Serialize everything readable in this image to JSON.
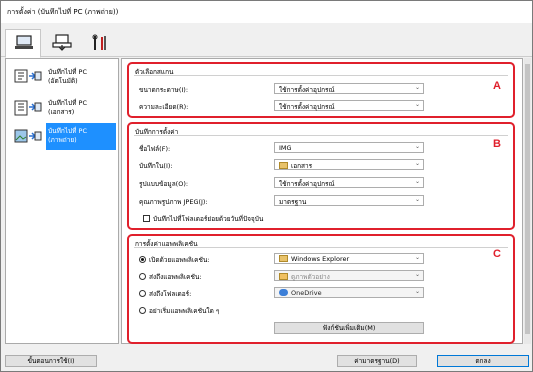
{
  "window": {
    "title": "การตั้งค่า (บันทึกไปที่ PC (ภาพถ่าย))"
  },
  "tabs": [
    {
      "icon": "computer-icon"
    },
    {
      "icon": "scanner-icon"
    },
    {
      "icon": "tools-icon"
    }
  ],
  "sidebar": {
    "items": [
      {
        "label": "บันทึกไปที่ PC (อัตโนมัติ)",
        "icon": "auto-scan-icon"
      },
      {
        "label": "บันทึกไปที่ PC (เอกสาร)",
        "icon": "document-scan-icon"
      },
      {
        "label": "บันทึกไปที่ PC (ภาพถ่าย)",
        "icon": "photo-scan-icon"
      }
    ]
  },
  "scan_options": {
    "title": "ตัวเลือกสแกน",
    "paper_size_label": "ขนาดกระดาษ(I):",
    "paper_size_value": "ใช้การตั้งค่าอุปกรณ์",
    "resolution_label": "ความละเอียด(R):",
    "resolution_value": "ใช้การตั้งค่าอุปกรณ์",
    "marker": "A"
  },
  "save_settings": {
    "title": "บันทึกการตั้งค่า",
    "file_name_label": "ชื่อไฟล์(F):",
    "file_name_value": "IMG",
    "save_in_label": "บันทึกใน(I):",
    "save_in_value": "เอกสาร",
    "data_format_label": "รูปแบบข้อมูล(O):",
    "data_format_value": "ใช้การตั้งค่าอุปกรณ์",
    "jpeg_quality_label": "คุณภาพรูปภาพ JPEG(J):",
    "jpeg_quality_value": "มาตรฐาน",
    "subfolder_label": "บันทึกไปที่โฟลเดอร์ย่อยด้วยวันที่ปัจจุบัน",
    "marker": "B"
  },
  "app_settings": {
    "title": "การตั้งค่าแอพพลิเคชัน",
    "open_with_label": "เปิดด้วยแอพพลิเคชัน:",
    "open_with_value": "Windows Explorer",
    "send_to_app_label": "ส่งถึงแอพพลิเคชัน:",
    "send_to_app_value": "ดูภาพตัวอย่าง",
    "send_to_folder_label": "ส่งถึงโฟลเดอร์:",
    "send_to_folder_value": "OneDrive",
    "no_app_label": "อย่าเริ่มแอพพลิเคชันใด ๆ",
    "more_functions_label": "ฟังก์ชันเพิ่มเติม(M)",
    "marker": "C"
  },
  "footer": {
    "instructions_label": "ขั้นตอนการใช้(I)",
    "defaults_label": "ค่ามาตรฐาน(D)",
    "ok_label": "ตกลง"
  }
}
